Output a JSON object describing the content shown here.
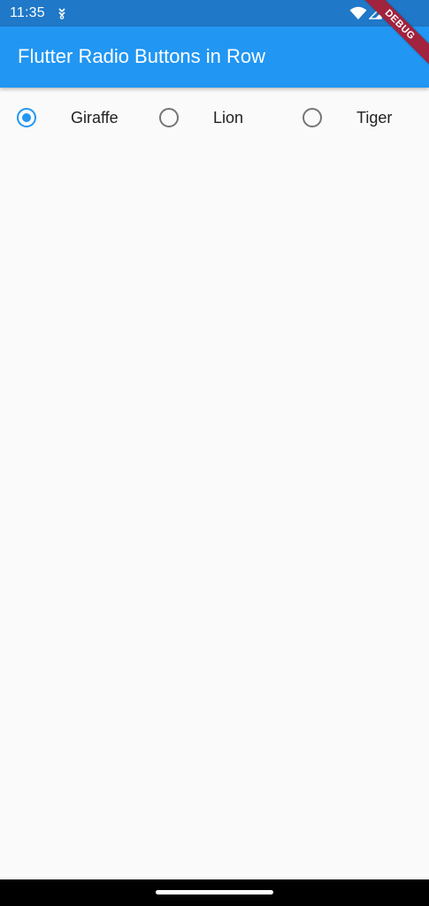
{
  "status_bar": {
    "time": "11:35",
    "icons": [
      "download-notification-icon",
      "wifi-icon",
      "cell-signal-icon"
    ],
    "color": "#1f78c8"
  },
  "app_bar": {
    "title": "Flutter Radio Buttons in Row",
    "color": "#2196f3"
  },
  "debug_banner": {
    "label": "DEBUG",
    "color": "#a1233d"
  },
  "radio_group": {
    "selected": "Giraffe",
    "accent_color": "#2196f3",
    "unselected_color": "#757575",
    "options": [
      {
        "label": "Giraffe",
        "selected": true
      },
      {
        "label": "Lion",
        "selected": false
      },
      {
        "label": "Tiger",
        "selected": false
      }
    ]
  },
  "nav_bar": {
    "icons": [
      "gesture-handle"
    ]
  }
}
